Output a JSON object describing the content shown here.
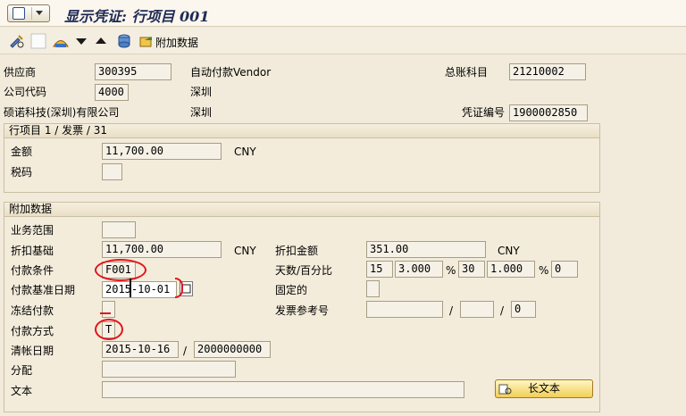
{
  "title": "显示凭证: 行项目 001",
  "toolbar": {
    "attach_label": "附加数据",
    "icons": [
      "display-change-icon",
      "blank-icon",
      "overview-icon",
      "next-item-icon",
      "previous-item-icon",
      "document-header-icon",
      "attach-data-icon"
    ]
  },
  "header": {
    "vendor_label": "供应商",
    "vendor_value": "300395",
    "vendor_desc": "自动付款Vendor",
    "gl_label": "总账科目",
    "gl_value": "21210002",
    "company_label": "公司代码",
    "company_value": "4000",
    "company_city": "深圳",
    "vendor_name": "硕诺科技(深圳)有限公司",
    "vendor_city": "深圳",
    "doc_no_label": "凭证编号",
    "doc_no_value": "1900002850"
  },
  "line_item": {
    "group_title": "行项目 1 / 发票 / 31",
    "amount_label": "金额",
    "amount_value": "11,700.00",
    "currency": "CNY",
    "tax_label": "税码",
    "tax_value": ""
  },
  "additional": {
    "group_title": "附加数据",
    "business_area_label": "业务范围",
    "business_area_value": "",
    "discount_base_label": "折扣基础",
    "discount_base_value": "11,700.00",
    "discount_base_currency": "CNY",
    "discount_amount_label": "折扣金额",
    "discount_amount_value": "351.00",
    "discount_amount_currency": "CNY",
    "payment_terms_label": "付款条件",
    "payment_terms_value": "F001",
    "days_pct_label": "天数/百分比",
    "days1": "15",
    "pct1": "3.000",
    "days2": "30",
    "pct2": "1.000",
    "days3": "0",
    "pct_sign": "%",
    "baseline_date_label": "付款基准日期",
    "baseline_date_value": "2015-10-01",
    "fixed_label": "固定的",
    "fixed_value": "",
    "block_label": "冻结付款",
    "block_value": "",
    "invoice_ref_label": "发票参考号",
    "invoice_ref_1": "",
    "invoice_ref_2": "",
    "invoice_ref_3": "0",
    "slash": "/",
    "payment_method_label": "付款方式",
    "payment_method_value": "T",
    "clearing_date_label": "清帐日期",
    "clearing_date_value": "2015-10-16",
    "clearing_doc_value": "2000000000",
    "assignment_label": "分配",
    "assignment_value": "",
    "text_label": "文本",
    "text_value": "",
    "long_text_button": "长文本"
  }
}
